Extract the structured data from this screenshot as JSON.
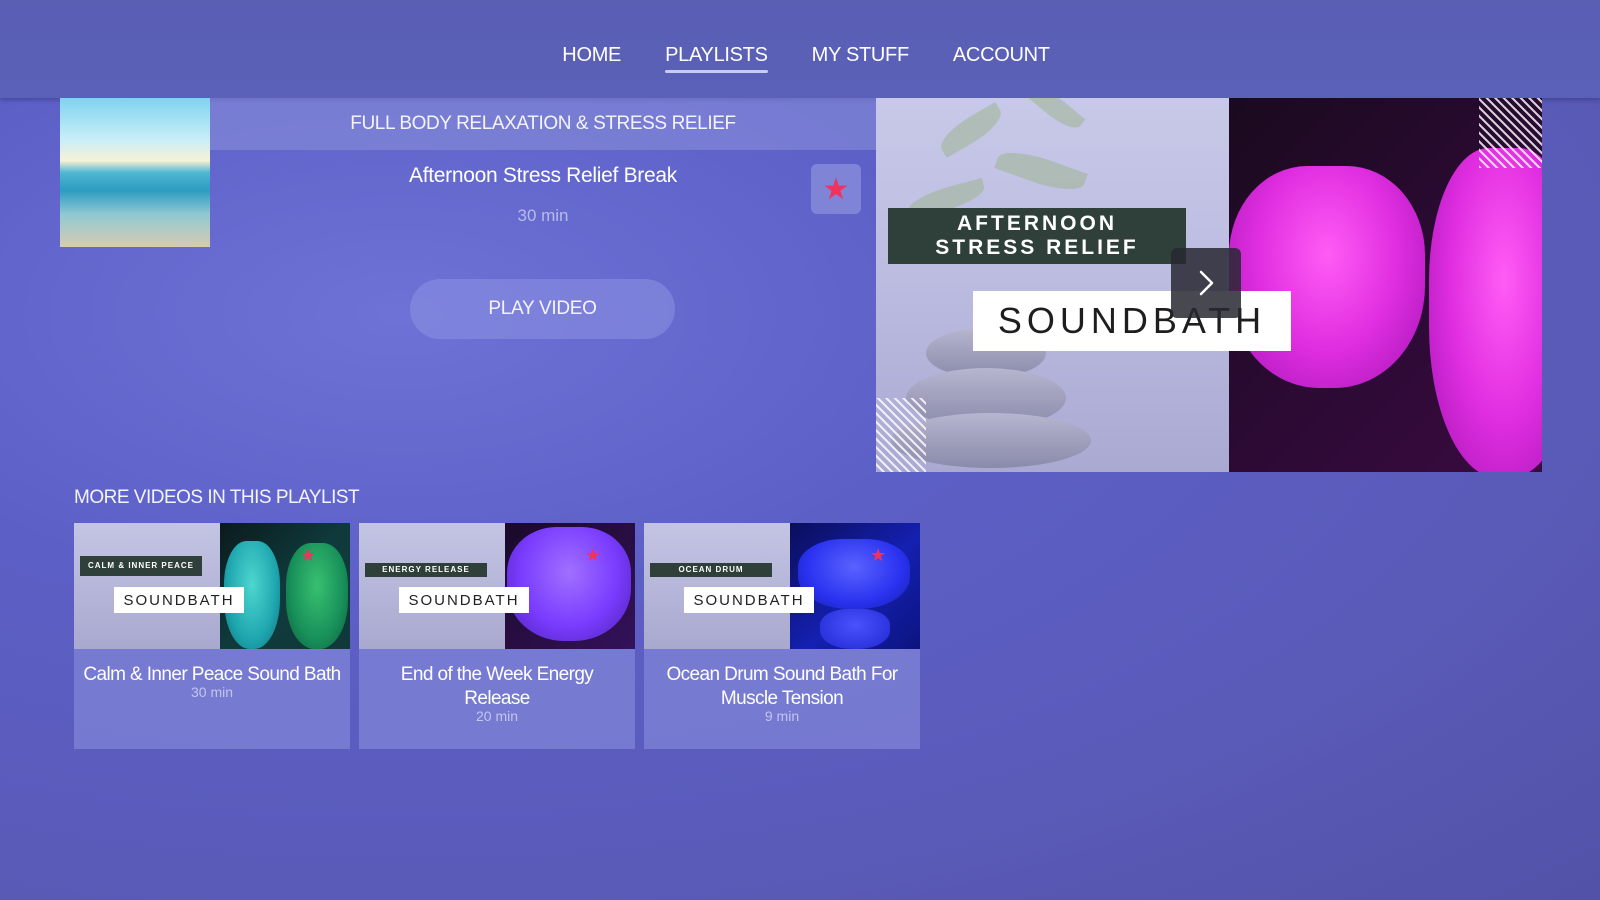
{
  "nav": {
    "items": [
      {
        "label": "HOME"
      },
      {
        "label": "PLAYLISTS",
        "active": true
      },
      {
        "label": "MY STUFF"
      },
      {
        "label": "ACCOUNT"
      }
    ]
  },
  "featured": {
    "category": "FULL BODY RELAXATION & STRESS RELIEF",
    "title": "Afternoon Stress Relief Break",
    "duration": "30 min",
    "favorite_icon": "star-icon",
    "play_label": "PLAY VIDEO",
    "hero": {
      "tag_line1": "AFTERNOON",
      "tag_line2": "STRESS RELIEF",
      "brand": "SOUNDBATH",
      "next_icon": "chevron-right-icon"
    }
  },
  "more_videos": {
    "heading": "MORE VIDEOS IN THIS PLAYLIST",
    "items": [
      {
        "tag": "CALM & INNER PEACE",
        "brand": "SOUNDBATH",
        "title": "Calm & Inner Peace Sound Bath",
        "duration": "30 min",
        "accent": "#1fa7b0"
      },
      {
        "tag": "ENERGY RELEASE",
        "brand": "SOUNDBATH",
        "title": "End of the Week Energy Release",
        "duration": "20 min",
        "accent": "#7a3cff"
      },
      {
        "tag": "OCEAN DRUM",
        "brand": "SOUNDBATH",
        "title": "Ocean Drum Sound Bath For Muscle Tension",
        "duration": "9 min",
        "accent": "#2a32f0"
      }
    ]
  },
  "colors": {
    "background": "#5c5fc6",
    "favorite_star": "#f0325c",
    "tag_background": "#2f3f3a"
  }
}
